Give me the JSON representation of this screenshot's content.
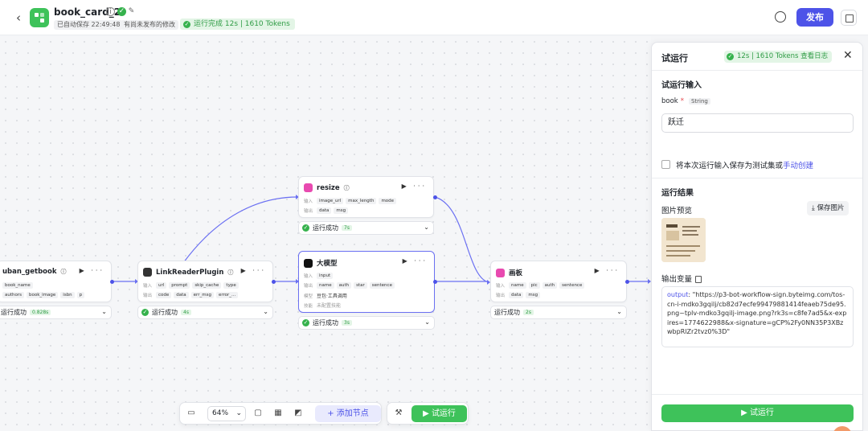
{
  "header": {
    "back": "‹",
    "title": "book_card_2",
    "autosave": "已自动保存 22:49:48",
    "unpublished": "有尚未发布的修改",
    "run_status": "运行完成 12s | 1610 Tokens",
    "publish": "发布"
  },
  "nodes": {
    "getbook": {
      "title": "uban_getbook",
      "inputs": [
        "book_name"
      ],
      "outputs": [
        "authors",
        "book_image",
        "isbn",
        "p"
      ],
      "status": "运行成功",
      "time": "0.828s"
    },
    "linkreader": {
      "title": "LinkReaderPlugin",
      "in_label": "输入",
      "inputs": [
        "url",
        "prompt",
        "skip_cache",
        "type"
      ],
      "out_label": "输出",
      "outputs": [
        "code",
        "data",
        "err_msg",
        "error_..."
      ],
      "status": "运行成功",
      "time": "4s"
    },
    "resize": {
      "title": "resize",
      "in_label": "输入",
      "inputs": [
        "image_url",
        "max_length",
        "mode"
      ],
      "out_label": "输出",
      "outputs": [
        "data",
        "msg"
      ],
      "status": "运行成功",
      "time": "7s"
    },
    "llm": {
      "title": "大模型",
      "in_label": "输入",
      "inputs": [
        "input"
      ],
      "out_label": "输出",
      "outputs": [
        "name",
        "auth",
        "star",
        "sentence"
      ],
      "model_label": "模型",
      "model": "豆包·工具调用",
      "skill_label": "技能",
      "skill": "未配置技能",
      "status": "运行成功",
      "time": "3s"
    },
    "canvas": {
      "title": "画板",
      "in_label": "输入",
      "inputs": [
        "name",
        "pic",
        "auth",
        "sentence"
      ],
      "out_label": "输出",
      "outputs": [
        "data",
        "msg"
      ],
      "status": "运行成功",
      "time": "2s"
    }
  },
  "toolbar": {
    "zoom": "64%",
    "add_node": "添加节点",
    "test_run": "试运行"
  },
  "panel": {
    "title": "试运行",
    "badge": "12s | 1610 Tokens  查看日志",
    "input_section": "试运行输入",
    "field_name": "book",
    "field_required": "*",
    "field_type": "String",
    "field_value": "跃迁",
    "save_text": "将本次运行输入保存为测试集或",
    "save_link": "手动创建",
    "result_section": "运行结果",
    "preview_label": "图片预览",
    "save_image": "保存图片",
    "output_label": "输出变量",
    "output_key": "output",
    "output_value": ": \"https://p3-bot-workflow-sign.byteimg.com/tos-cn-i-mdko3gqilj/cb82d7ecfe99479881414feaeb75de95.png~tplv-mdko3gqilj-image.png?rk3s=c8fe7ad5&x-expires=1774622988&x-signature=gCP%2Fy0NN35P3XBzwbpRlZr2tvz0%3D\"",
    "run_button": "试运行"
  },
  "colors": {
    "brand_green": "#3ec25a",
    "accent_purple": "#4d53e8",
    "edge": "#6b70f2"
  }
}
